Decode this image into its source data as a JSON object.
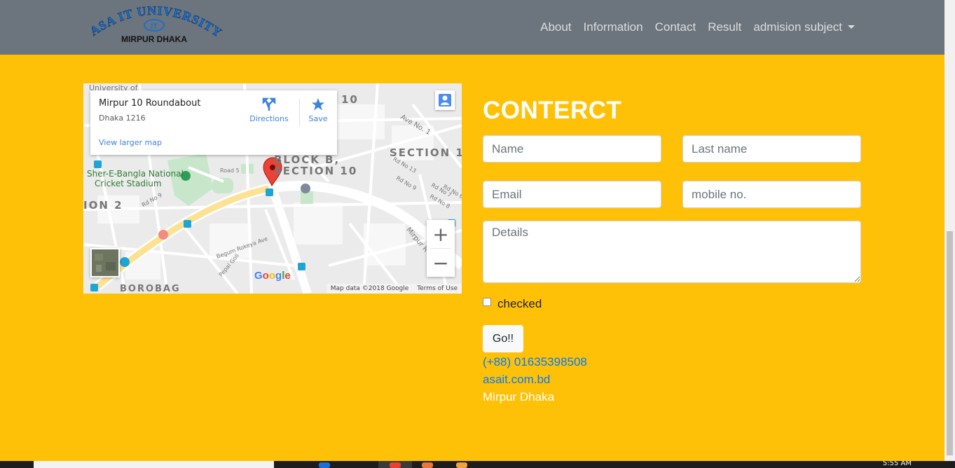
{
  "navbar": {
    "logo_text_top": "ASA IT UNIVERSITY",
    "logo_text_bottom": "MIRPUR DHAKA",
    "logo_mark": "IT",
    "links": [
      {
        "label": "About"
      },
      {
        "label": "Information"
      },
      {
        "label": "Contact"
      },
      {
        "label": "Result"
      }
    ],
    "dropdown_label": "admision subject",
    "bg_color": "#6c757d"
  },
  "map": {
    "place_name": "Mirpur 10 Roundabout",
    "place_address": "Dhaka 1216",
    "view_larger_label": "View larger map",
    "directions_label": "Directions",
    "save_label": "Save",
    "zoom_in": "+",
    "zoom_out": "−",
    "attribution": "Map data ©2018 Google",
    "terms": "Terms of Use",
    "google_logo": "Google",
    "labels": {
      "university": "University of",
      "section10_top": "10",
      "block_b": "BLOCK B,",
      "section10": "SECTION 10",
      "section1": "SECTION 1",
      "stadium_l1": "Sher-E-Bangla National",
      "stadium_l2": "Cricket Stadium",
      "section2": "ION 2",
      "borobag": "BOROBAG",
      "ave1": "Ave No. 1",
      "mirpur_rd": "Mirpur R",
      "road5": "Road 5",
      "rd9": "Rd No 9",
      "rd9b": "Rd No 9",
      "rd7": "Rd No 7",
      "rd8": "Rd No 8",
      "rd6": "Rd No 6",
      "rd13": "Rd No 13",
      "pepal": "Pepal Goli",
      "begum": "Begum Rokeya Ave"
    }
  },
  "form": {
    "title": "CONTERCT",
    "name_placeholder": "Name",
    "lastname_placeholder": "Last name",
    "email_placeholder": "Email",
    "mobile_placeholder": "mobile no.",
    "details_placeholder": "Details",
    "checkbox_label": "checked",
    "submit_label": "Go!!"
  },
  "contact": {
    "phone": "(+88) 01635398508",
    "website": "asait.com.bd",
    "location": "Mirpur Dhaka"
  },
  "taskbar": {
    "time": "5:55 AM"
  },
  "colors": {
    "page_bg": "#ffc107",
    "link": "#007bff",
    "marker": "#ea4335"
  }
}
